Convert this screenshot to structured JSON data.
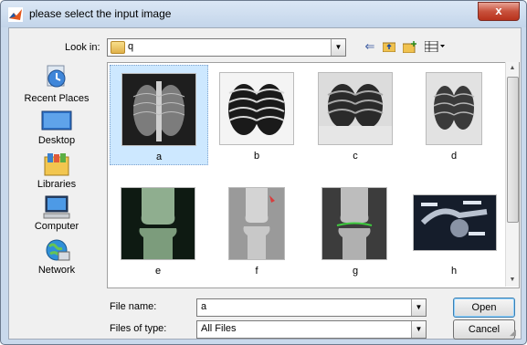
{
  "window": {
    "title": "please select the input image",
    "close_label": "x"
  },
  "lookin": {
    "label": "Look in:",
    "value": "q",
    "icons": [
      "back-arrow-icon",
      "up-folder-icon",
      "new-folder-icon",
      "view-menu-icon"
    ]
  },
  "places": [
    {
      "label": "Recent Places",
      "icon": "recent-places-icon"
    },
    {
      "label": "Desktop",
      "icon": "desktop-icon"
    },
    {
      "label": "Libraries",
      "icon": "libraries-icon"
    },
    {
      "label": "Computer",
      "icon": "computer-icon"
    },
    {
      "label": "Network",
      "icon": "network-icon"
    }
  ],
  "files": [
    {
      "name": "a",
      "selected": true
    },
    {
      "name": "b",
      "selected": false
    },
    {
      "name": "c",
      "selected": false
    },
    {
      "name": "d",
      "selected": false
    },
    {
      "name": "e",
      "selected": false
    },
    {
      "name": "f",
      "selected": false
    },
    {
      "name": "g",
      "selected": false
    },
    {
      "name": "h",
      "selected": false
    }
  ],
  "filename": {
    "label": "File name:",
    "value": "a"
  },
  "filetype": {
    "label": "Files of type:",
    "value": "All Files"
  },
  "buttons": {
    "open": "Open",
    "cancel": "Cancel"
  },
  "colors": {
    "accent": "#3c7fb1",
    "selection": "#cde8ff",
    "close": "#c8513c"
  }
}
